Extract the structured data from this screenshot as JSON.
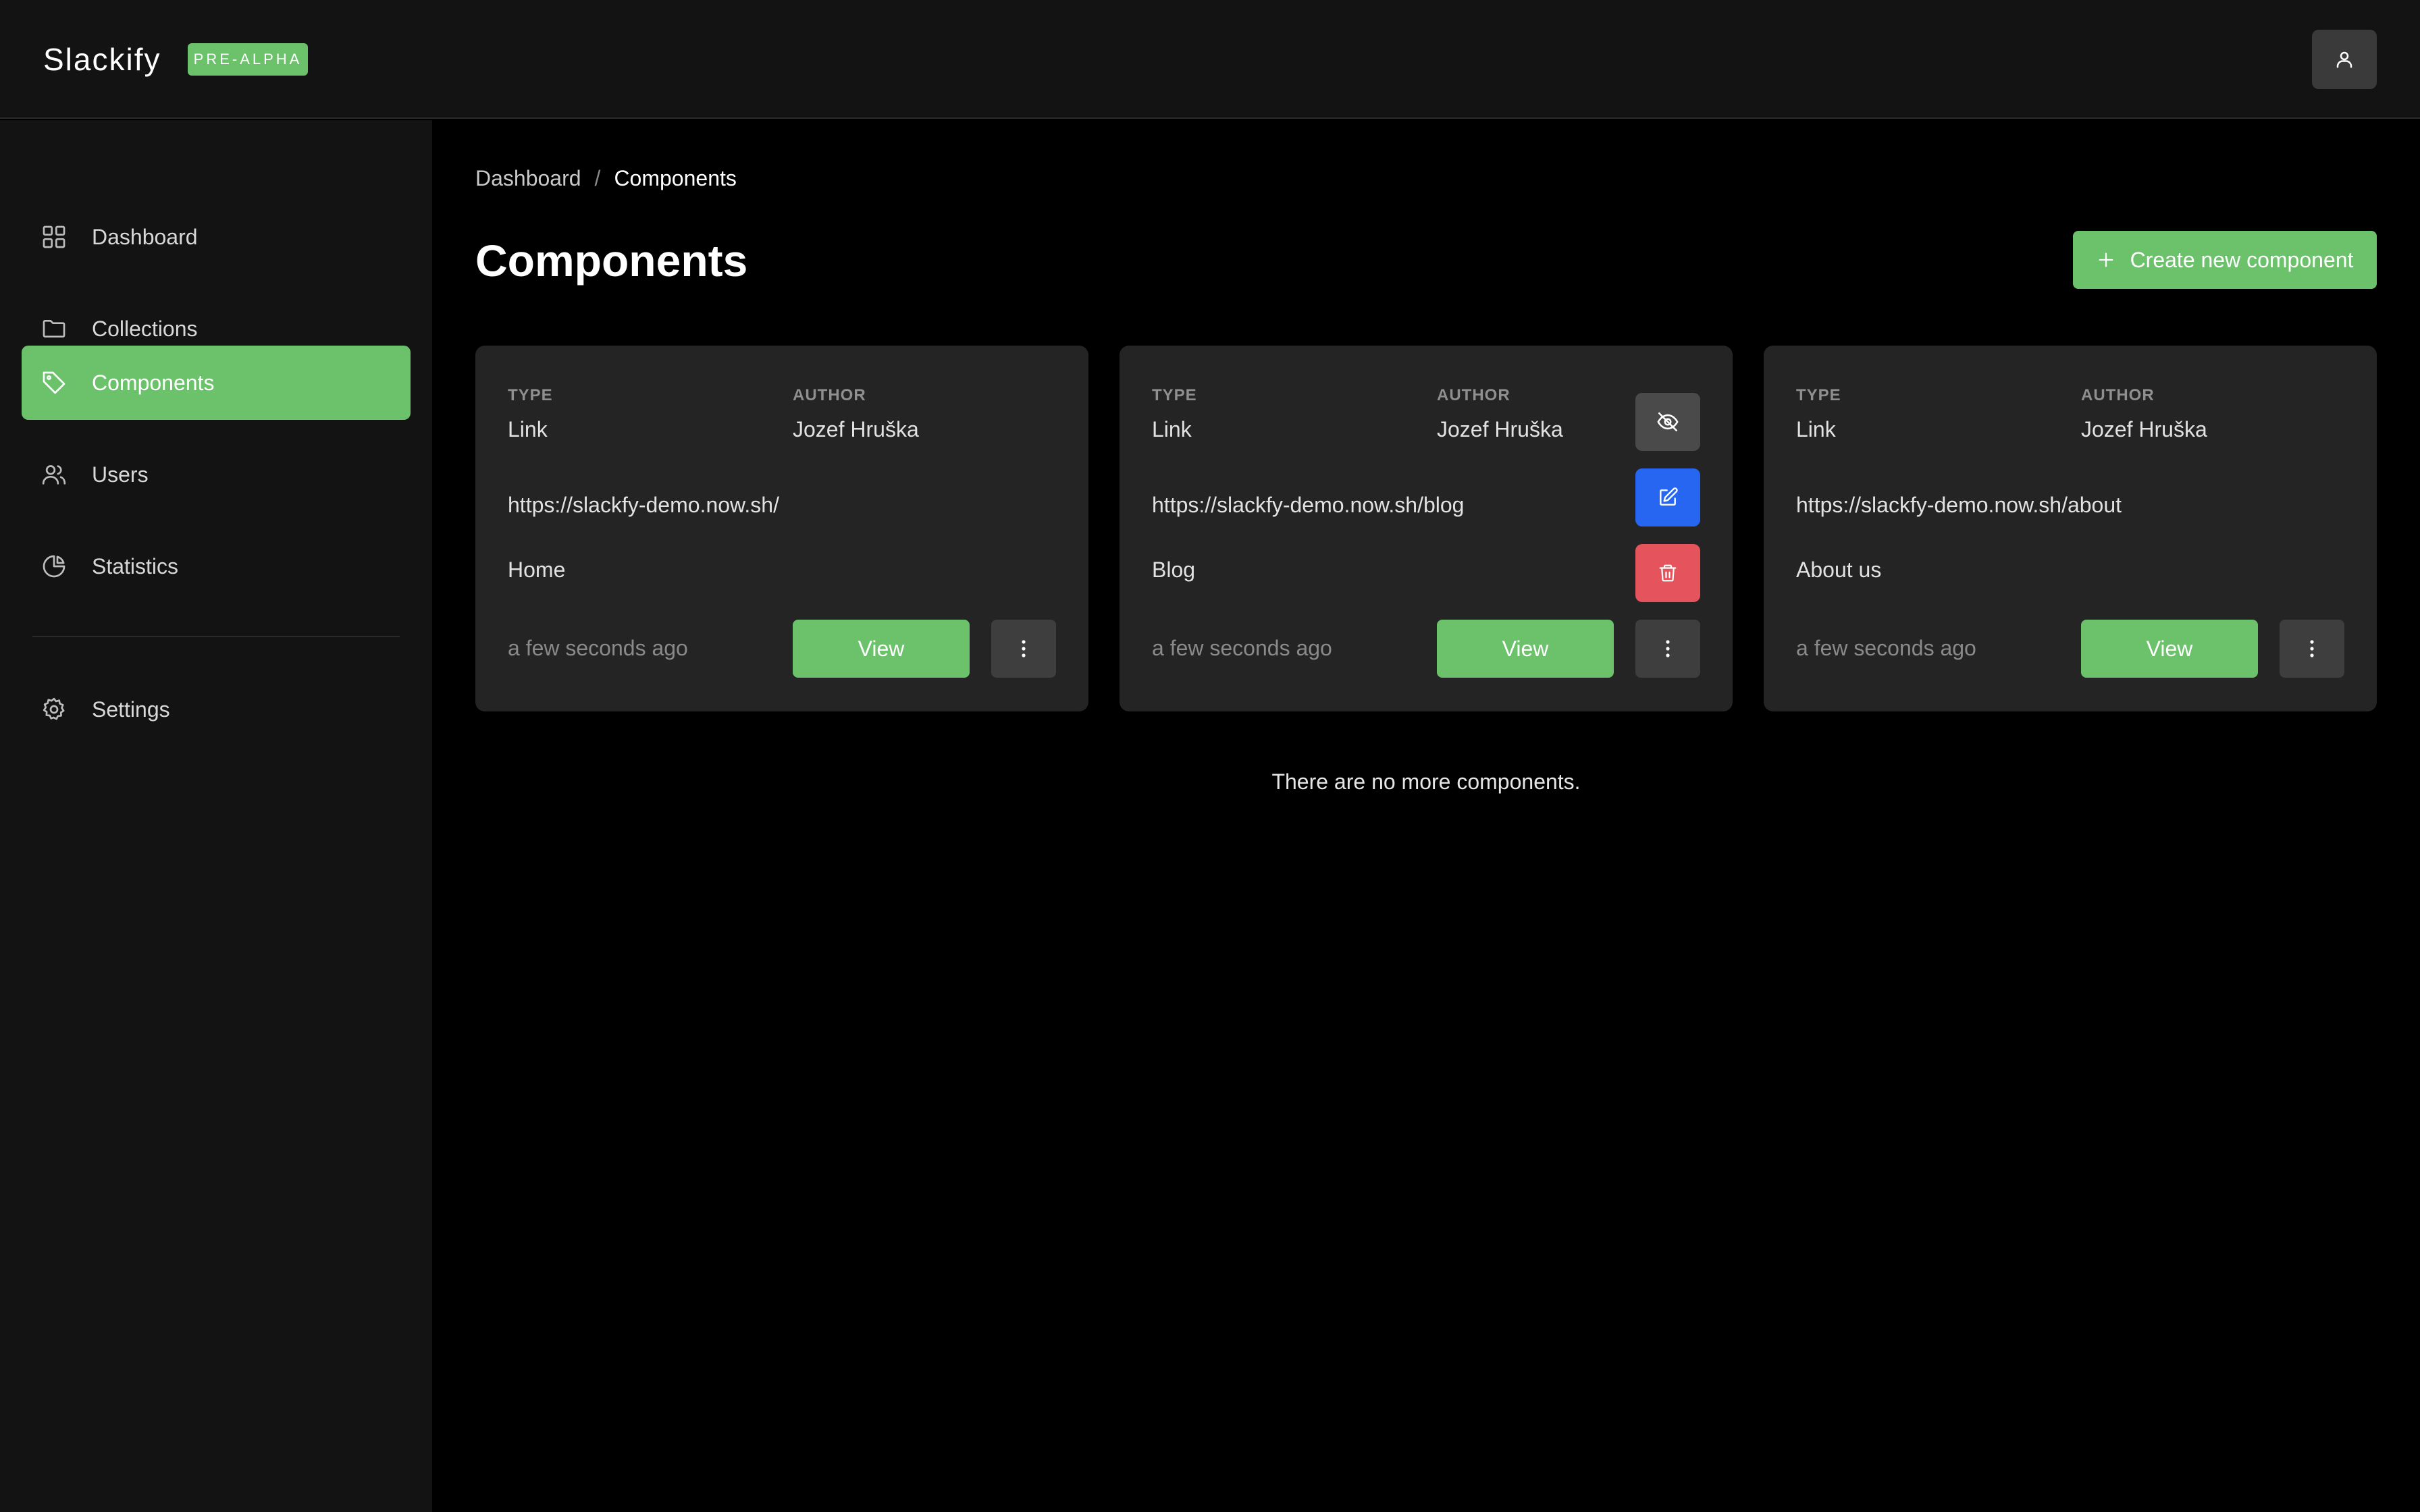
{
  "app": {
    "name": "Slackify",
    "badge": "PRE-ALPHA"
  },
  "sidebar": {
    "items": [
      {
        "label": "Dashboard",
        "icon": "grid-icon"
      },
      {
        "label": "Collections",
        "icon": "folder-icon"
      },
      {
        "label": "Components",
        "icon": "tag-icon",
        "active": true
      },
      {
        "label": "Users",
        "icon": "users-icon"
      },
      {
        "label": "Statistics",
        "icon": "pie-chart-icon"
      },
      {
        "label": "Settings",
        "icon": "gear-icon"
      }
    ]
  },
  "breadcrumb": {
    "parent": "Dashboard",
    "separator": "/",
    "current": "Components"
  },
  "page": {
    "title": "Components",
    "create_label": "Create new component",
    "empty_note": "There are no more components."
  },
  "card_labels": {
    "type": "TYPE",
    "author": "AUTHOR",
    "view": "View"
  },
  "cards": [
    {
      "type": "Link",
      "author": "Jozef Hruška",
      "url": "https://slackfy-demo.now.sh/",
      "name": "Home",
      "time": "a few seconds ago"
    },
    {
      "type": "Link",
      "author": "Jozef Hruška",
      "url": "https://slackfy-demo.now.sh/blog",
      "name": "Blog",
      "time": "a few seconds ago",
      "actions": [
        "eye-off-icon",
        "edit-icon",
        "trash-icon"
      ]
    },
    {
      "type": "Link",
      "author": "Jozef Hruška",
      "url": "https://slackfy-demo.now.sh/about",
      "name": "About us",
      "time": "a few seconds ago"
    }
  ],
  "colors": {
    "accent": "#6bc26b",
    "edit": "#2766f0",
    "delete": "#e5535c",
    "card": "#242424",
    "sidebar": "#131313"
  }
}
